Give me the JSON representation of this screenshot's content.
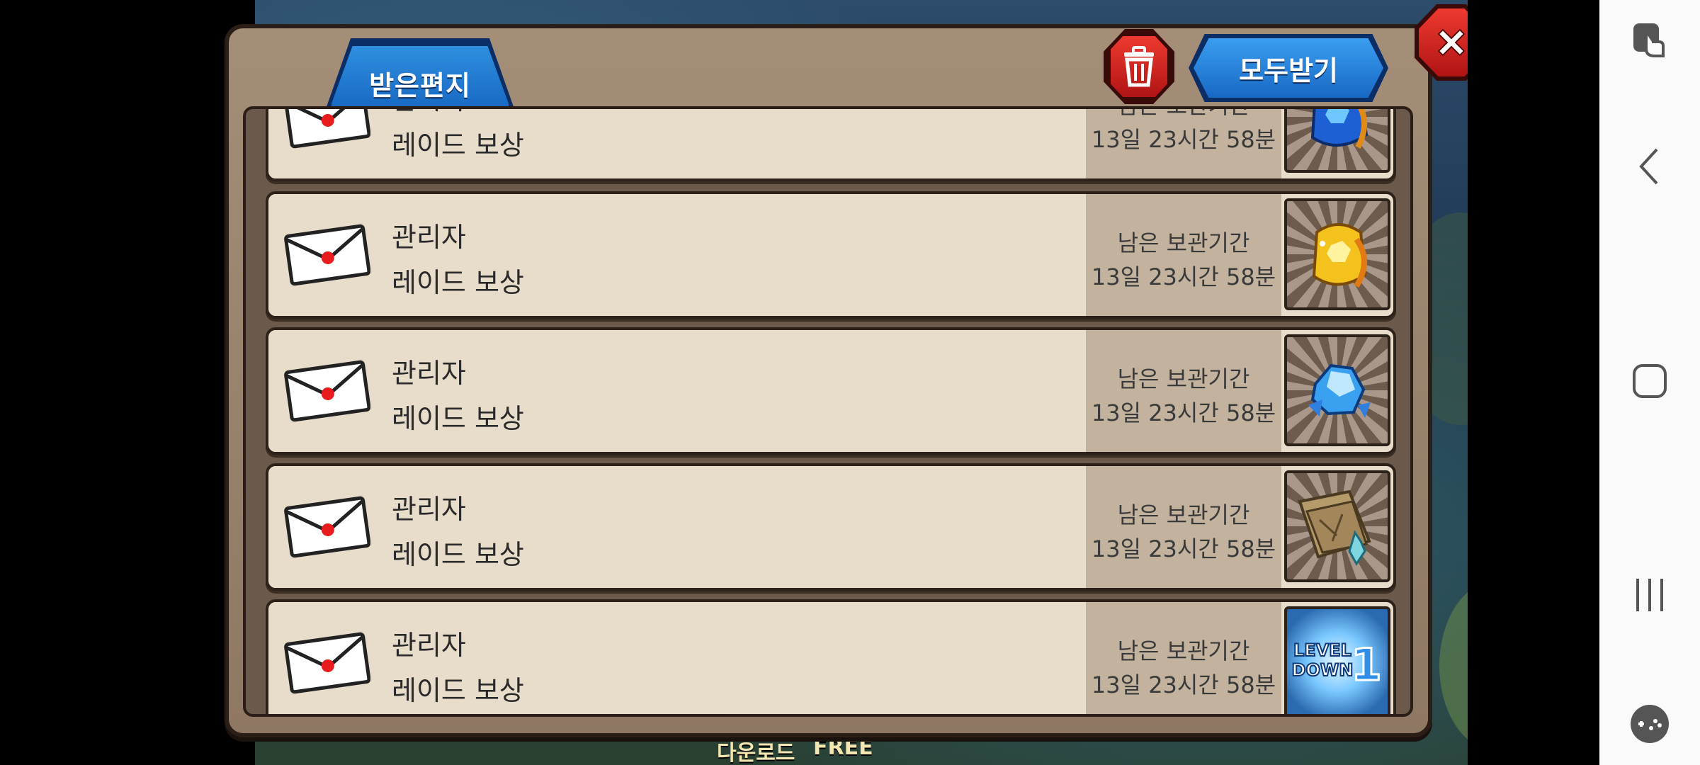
{
  "popup": {
    "tab_label": "받은편지",
    "receive_all_label": "모두받기"
  },
  "mails": [
    {
      "sender": "관리자",
      "title": "레이드 보상",
      "expiry_label": "남은 보관기간",
      "expiry_time": "13일 23시간 58분",
      "reward": "blue-gem-pouch-icon"
    },
    {
      "sender": "관리자",
      "title": "레이드 보상",
      "expiry_label": "남은 보관기간",
      "expiry_time": "13일 23시간 58분",
      "reward": "gold-gem-pouch-icon"
    },
    {
      "sender": "관리자",
      "title": "레이드 보상",
      "expiry_label": "남은 보관기간",
      "expiry_time": "13일 23시간 58분",
      "reward": "blue-crystal-icon"
    },
    {
      "sender": "관리자",
      "title": "레이드 보상",
      "expiry_label": "남은 보관기간",
      "expiry_time": "13일 23시간 58분",
      "reward": "map-scroll-icon"
    },
    {
      "sender": "관리자",
      "title": "레이드 보상",
      "expiry_label": "남은 보관기간",
      "expiry_time": "13일 23시간 58분",
      "reward": "level-down-ticket-icon",
      "reward_text": [
        "LEVEL",
        "DOWN",
        "1"
      ]
    }
  ],
  "background": {
    "bottom_left_text": "다운로드",
    "bottom_right_text": "FREE"
  },
  "colors": {
    "tab_blue": "#1e78d2",
    "button_red": "#d42a22",
    "row_bg": "#e8dccb",
    "frame_brown": "#a48e78"
  },
  "nav_bar": {
    "icons": [
      "gesture-lock-icon",
      "back-icon",
      "home-icon",
      "recents-icon",
      "game-launcher-icon"
    ]
  }
}
